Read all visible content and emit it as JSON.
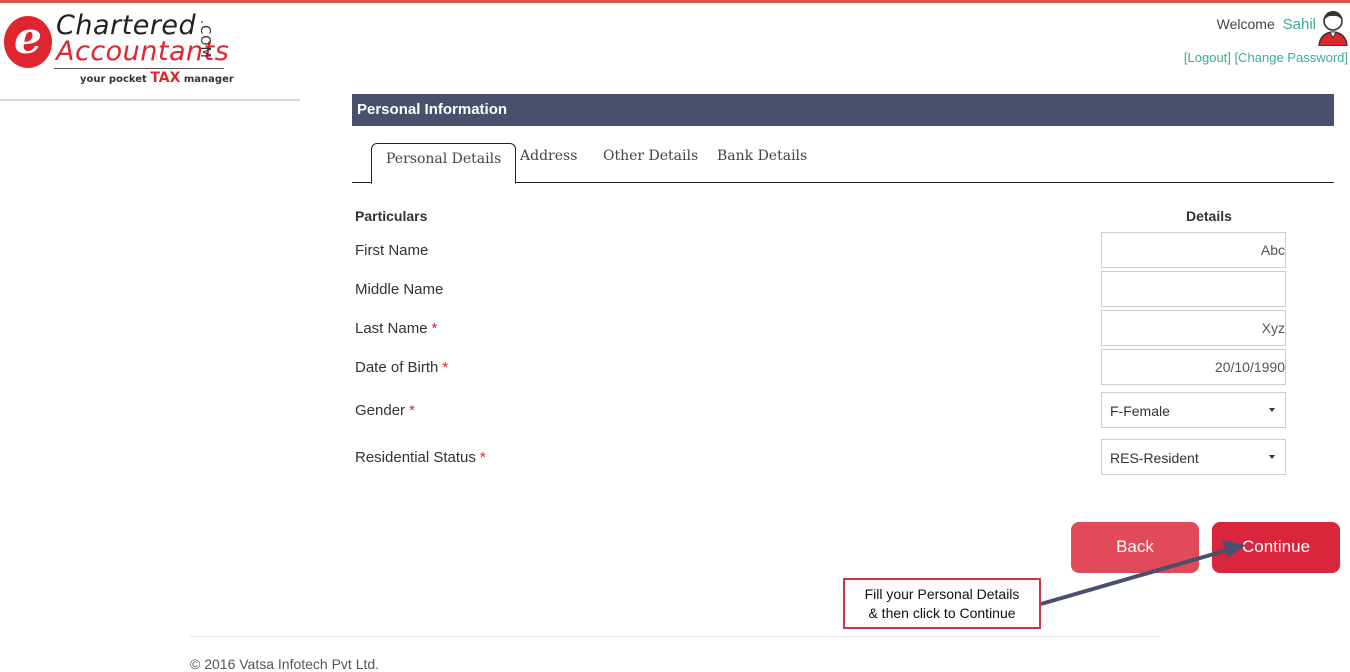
{
  "brand": {
    "logo_letter": "e",
    "line1": "Chartered",
    "line2": "Accountants",
    "suffix": ".COM",
    "tagline_pre": "your pocket",
    "tagline_tax": "TAX",
    "tagline_post": "manager"
  },
  "header": {
    "welcome_label": "Welcome",
    "username": "Sahil",
    "logout_link": "[Logout]",
    "change_password_link": "[Change Password]"
  },
  "panel": {
    "title": "Personal Information",
    "tabs": [
      {
        "label": "Personal Details",
        "active": true
      },
      {
        "label": "Address",
        "active": false
      },
      {
        "label": "Other Details",
        "active": false
      },
      {
        "label": "Bank Details",
        "active": false
      }
    ],
    "col_particulars": "Particulars",
    "col_details": "Details"
  },
  "form": {
    "first_name": {
      "label": "First Name",
      "value": "Abc",
      "required": false
    },
    "middle_name": {
      "label": "Middle Name",
      "value": "",
      "required": false
    },
    "last_name": {
      "label": "Last Name",
      "value": "Xyz",
      "required": true
    },
    "dob": {
      "label": "Date of Birth",
      "value": "20/10/1990",
      "required": true
    },
    "gender": {
      "label": "Gender",
      "value": "F-Female",
      "required": true
    },
    "residential_status": {
      "label": "Residential Status",
      "value": "RES-Resident",
      "required": true
    },
    "required_marker": "*"
  },
  "actions": {
    "back_label": "Back",
    "continue_label": "Continue"
  },
  "callout": {
    "line1": "Fill your Personal Details",
    "line2": "& then click to Continue"
  },
  "footer": {
    "copyright": "© 2016 Vatsa Infotech Pvt Ltd."
  },
  "colors": {
    "panel_header": "#4a4f6e",
    "accent_red": "#d9263d",
    "link_teal": "#3aab9a"
  }
}
